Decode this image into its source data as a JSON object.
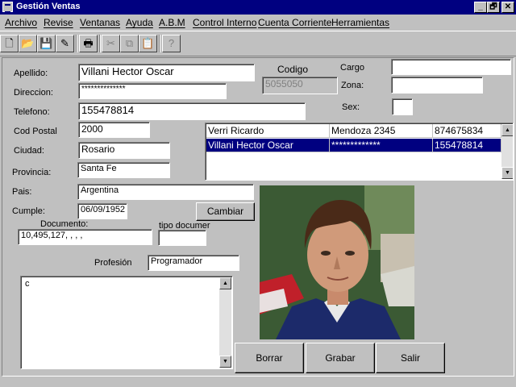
{
  "window": {
    "title": "Gestión Ventas",
    "controls": {
      "minimize": "_",
      "restore": "🗗",
      "close": "✕"
    }
  },
  "menu": {
    "items": [
      "Archivo",
      "Revise",
      "Ventanas",
      "Ayuda",
      "A.B.M",
      "Control Interno",
      "Cuenta Corriente",
      "Herramientas"
    ]
  },
  "toolbar": {
    "buttons": [
      {
        "name": "new-file-icon",
        "glyph": "🗋"
      },
      {
        "name": "open-folder-icon",
        "glyph": "📂"
      },
      {
        "name": "save-disk-icon",
        "glyph": "💾"
      },
      {
        "name": "edit-pencil-icon",
        "glyph": "✎"
      },
      {
        "name": "print-icon",
        "glyph": "🖶"
      },
      {
        "name": "cut-icon",
        "glyph": "✂"
      },
      {
        "name": "copy-icon",
        "glyph": "⧉"
      },
      {
        "name": "paste-icon",
        "glyph": "📋"
      },
      {
        "name": "help-icon",
        "glyph": "?"
      }
    ]
  },
  "form": {
    "apellido": {
      "label": "Apellido:",
      "value": "Villani Hector Oscar"
    },
    "direccion": {
      "label": "Direccion:",
      "value": "**************"
    },
    "telefono": {
      "label": "Telefono:",
      "value": "155478814"
    },
    "cod_postal": {
      "label": "Cod Postal",
      "value": "2000"
    },
    "ciudad": {
      "label": "Ciudad:",
      "value": "Rosario"
    },
    "provincia": {
      "label": "Provincia:",
      "value": "Santa Fe"
    },
    "pais": {
      "label": "Pais:",
      "value": "Argentina"
    },
    "cumple": {
      "label": "Cumple:",
      "value": "06/09/1952"
    },
    "cambiar_label": "Cambiar",
    "documento": {
      "label": "Documento:",
      "value": "10,495,127,  ,  ,  ,"
    },
    "tipo_documento": {
      "label": "tipo documer",
      "value": ""
    },
    "profesion": {
      "label": "Profesión",
      "value": "Programador"
    },
    "notes": {
      "value": "c"
    },
    "codigo": {
      "label": "Codigo",
      "value": "5055050"
    },
    "cargo": {
      "label": "Cargo",
      "value": ""
    },
    "zona": {
      "label": "Zona:",
      "value": ""
    },
    "sex": {
      "label": "Sex:",
      "value": ""
    }
  },
  "grid": {
    "rows": [
      {
        "name": "Verri Ricardo",
        "address": "Mendoza 2345",
        "phone": "874675834",
        "selected": false
      },
      {
        "name": "Villani Hector Oscar",
        "address": "*************",
        "phone": "155478814",
        "selected": true
      }
    ]
  },
  "actions": {
    "borrar": "Borrar",
    "grabar": "Grabar",
    "salir": "Salir"
  },
  "colors": {
    "titlebar": "#000080",
    "selection": "#000080",
    "face": "#c0c0c0"
  }
}
